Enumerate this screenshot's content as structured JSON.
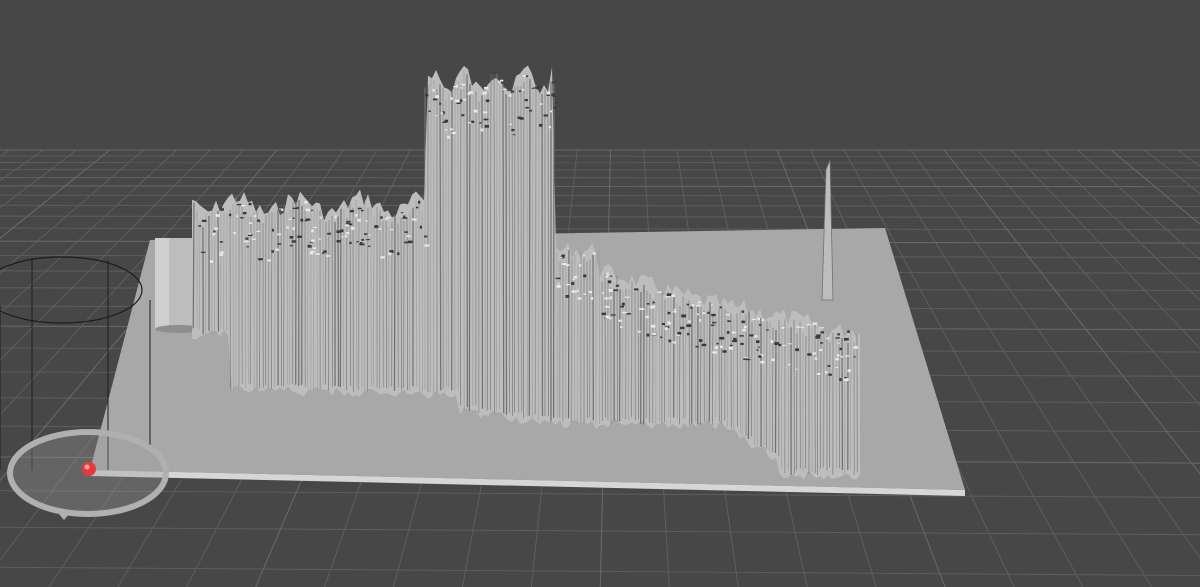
{
  "viewport": {
    "label": "",
    "background": "#474747",
    "grid_color": "#5e5e5e",
    "grid_major_color": "#6a6a6a",
    "plate_color": "#a8a8a8",
    "plate_edge_color": "#d6d6d6",
    "model_color": "#bdbdbd",
    "model_shadow_color": "#707070",
    "gizmo_color": "#1c1c1c",
    "gizmo_ring_color": "#b0b0b0",
    "handle_color": "#e23b3b"
  },
  "scene": {
    "model_name": "",
    "plate_name": "",
    "cylinder_gizmo": "cylinder-wireframe-icon",
    "move_handle": "red-sphere-handle-icon"
  },
  "gizmo_caption": ""
}
